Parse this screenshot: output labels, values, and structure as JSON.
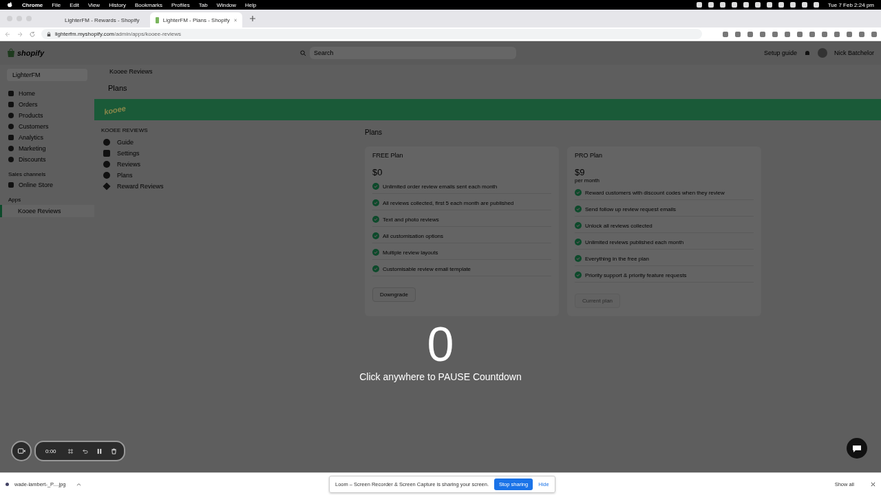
{
  "menu_bar": {
    "app": "Chrome",
    "items": [
      "File",
      "Edit",
      "View",
      "History",
      "Bookmarks",
      "Profiles",
      "Tab",
      "Window",
      "Help"
    ],
    "clock": "Tue 7 Feb  2:24 pm"
  },
  "browser": {
    "tabs": [
      {
        "title": "LighterFM - Rewards - Shopify",
        "selected": false
      },
      {
        "title": "LighterFM - Plans - Shopify",
        "selected": true
      }
    ],
    "url_host": "lighterfm.myshopify.com",
    "url_path": "/admin/apps/kooee-reviews"
  },
  "shopify": {
    "logo": "shopify",
    "search_placeholder": "Search",
    "setup_guide": "Setup guide",
    "user": "Nick Batchelor",
    "store": "LighterFM",
    "nav": [
      "Home",
      "Orders",
      "Products",
      "Customers",
      "Analytics",
      "Marketing",
      "Discounts"
    ],
    "sales_channels_heading": "Sales channels",
    "channels": [
      "Online Store"
    ],
    "apps_heading": "Apps",
    "apps": [
      {
        "label": "Kooee Reviews",
        "selected": true
      }
    ]
  },
  "app": {
    "breadcrumb": "Kooee Reviews",
    "page_title": "Plans",
    "banner_logo": "kooee",
    "nav_heading": "KOOEE REVIEWS",
    "nav": [
      "Guide",
      "Settings",
      "Reviews",
      "Plans",
      "Reward Reviews"
    ],
    "plans_heading": "Plans",
    "plans": [
      {
        "name": "FREE Plan",
        "price": "$0",
        "features": [
          "Unlimited order review emails sent each month",
          "All reviews collected, first 5 each month are published",
          "Text and photo reviews",
          "All customisation options",
          "Multiple review layouts",
          "Customisable review email template"
        ],
        "button": "Downgrade",
        "disabled": false
      },
      {
        "name": "PRO Plan",
        "price": "$9",
        "period": "per month",
        "features": [
          "Reward customers with discount codes when they review",
          "Send follow up review request emails",
          "Unlock all reviews collected",
          "Unlimited reviews published each month",
          "Everything in the free plan",
          "Priority support & priority feature requests"
        ],
        "button": "Current plan",
        "disabled": true
      }
    ]
  },
  "countdown": {
    "number": "0",
    "hint": "Click anywhere to PAUSE Countdown"
  },
  "recorder": {
    "timer": "0:00"
  },
  "download_bar": {
    "file": "wade-lambert-_P....jpg",
    "notice": "Loom – Screen Recorder & Screen Capture is sharing your screen.",
    "stop_button": "Stop sharing",
    "hide_link": "Hide",
    "show_all": "Show all"
  }
}
